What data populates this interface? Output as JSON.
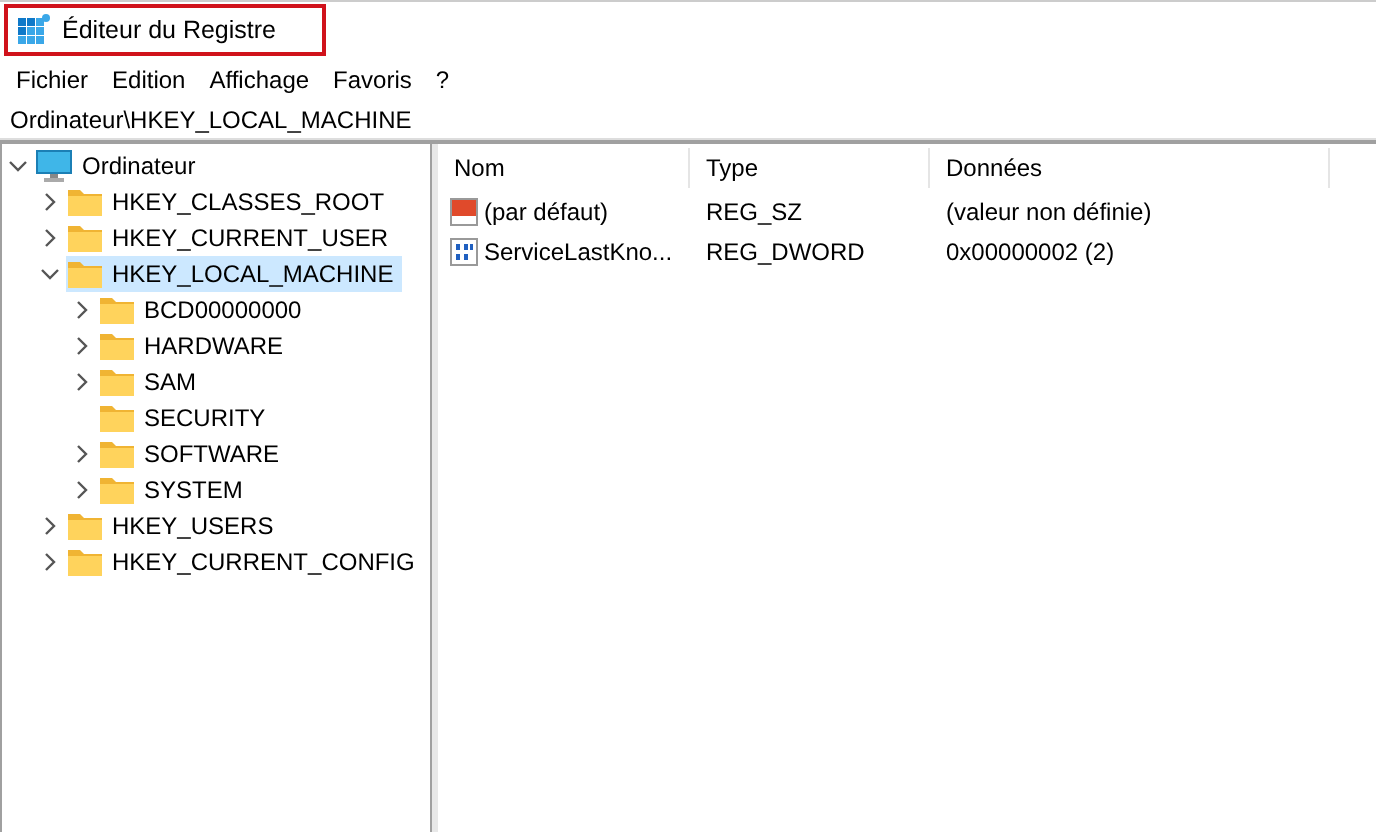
{
  "window": {
    "title": "Éditeur du Registre",
    "title_highlighted": true
  },
  "menu": [
    "Fichier",
    "Edition",
    "Affichage",
    "Favoris",
    "?"
  ],
  "address": "Ordinateur\\HKEY_LOCAL_MACHINE",
  "tree": {
    "label": "Ordinateur",
    "kind": "computer",
    "expanded": true,
    "has_children": true,
    "selected": false,
    "children": [
      {
        "label": "HKEY_CLASSES_ROOT",
        "kind": "folder",
        "expanded": false,
        "has_children": true,
        "selected": false
      },
      {
        "label": "HKEY_CURRENT_USER",
        "kind": "folder",
        "expanded": false,
        "has_children": true,
        "selected": false
      },
      {
        "label": "HKEY_LOCAL_MACHINE",
        "kind": "folder",
        "expanded": true,
        "has_children": true,
        "selected": true,
        "children": [
          {
            "label": "BCD00000000",
            "kind": "folder",
            "expanded": false,
            "has_children": true,
            "selected": false
          },
          {
            "label": "HARDWARE",
            "kind": "folder",
            "expanded": false,
            "has_children": true,
            "selected": false
          },
          {
            "label": "SAM",
            "kind": "folder",
            "expanded": false,
            "has_children": true,
            "selected": false
          },
          {
            "label": "SECURITY",
            "kind": "folder",
            "expanded": false,
            "has_children": false,
            "selected": false
          },
          {
            "label": "SOFTWARE",
            "kind": "folder",
            "expanded": false,
            "has_children": true,
            "selected": false
          },
          {
            "label": "SYSTEM",
            "kind": "folder",
            "expanded": false,
            "has_children": true,
            "selected": false
          }
        ]
      },
      {
        "label": "HKEY_USERS",
        "kind": "folder",
        "expanded": false,
        "has_children": true,
        "selected": false
      },
      {
        "label": "HKEY_CURRENT_CONFIG",
        "kind": "folder",
        "expanded": false,
        "has_children": true,
        "selected": false
      }
    ]
  },
  "values": {
    "columns": [
      "Nom",
      "Type",
      "Données"
    ],
    "rows": [
      {
        "kind": "string",
        "name": "(par défaut)",
        "type": "REG_SZ",
        "data": "(valeur non définie)"
      },
      {
        "kind": "binary",
        "name": "ServiceLastKno...",
        "type": "REG_DWORD",
        "data": "0x00000002 (2)"
      }
    ]
  }
}
